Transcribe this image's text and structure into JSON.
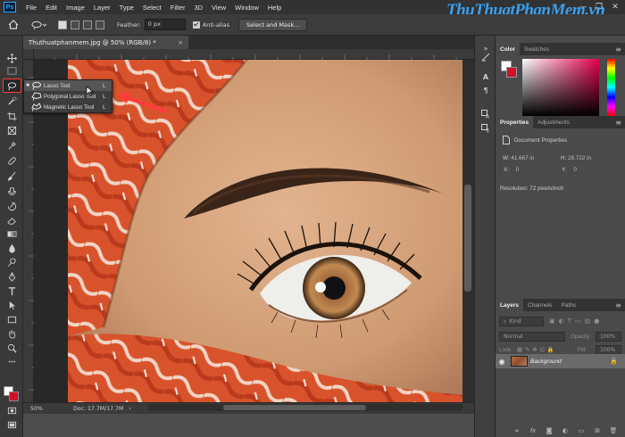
{
  "app": {
    "logo": "Ps"
  },
  "menu": [
    "File",
    "Edit",
    "Image",
    "Layer",
    "Type",
    "Select",
    "Filter",
    "3D",
    "View",
    "Window",
    "Help"
  ],
  "window_controls": {
    "minimize": "—",
    "maximize": "❐",
    "close": "✕"
  },
  "watermark": "ThuThuatPhanMem.vn",
  "options": {
    "feather_label": "Feather:",
    "feather_value": "0 px",
    "antialias_label": "Anti-alias",
    "select_mask_label": "Select and Mask..."
  },
  "document": {
    "tab_title": "Thuthuatphanmem.jpg @ 50% (RGB/8) *",
    "tab_close": "×",
    "zoom": "50%",
    "doc_size": "Doc: 17.7M/17.7M"
  },
  "flyout": {
    "items": [
      {
        "marker": "■",
        "label": "Lasso Tool",
        "key": "L"
      },
      {
        "marker": "",
        "label": "Polygonal Lasso Tool",
        "key": "L"
      },
      {
        "marker": "",
        "label": "Magnetic Lasso Tool",
        "key": "L"
      }
    ]
  },
  "color_panel": {
    "tabs": [
      "Color",
      "Swatches"
    ]
  },
  "properties_panel": {
    "tabs": [
      "Properties",
      "Adjustments"
    ],
    "doc_props": "Document Properties",
    "w_label": "W:",
    "w_value": "41.667 in",
    "h_label": "H:",
    "h_value": "28.722 in",
    "x_label": "X:",
    "x_value": "0",
    "y_label": "Y:",
    "y_value": "0",
    "resolution": "Resolution: 72 pixels/inch"
  },
  "layers_panel": {
    "tabs": [
      "Layers",
      "Channels",
      "Paths"
    ],
    "filter_placeholder": "Kind",
    "blend_mode": "Normal",
    "opacity_label": "Opacity:",
    "opacity_value": "100%",
    "lock_label": "Lock:",
    "fill_label": "Fill:",
    "fill_value": "100%",
    "layer_name": "Background"
  },
  "colors": {
    "foreground": "#ffffff",
    "background": "#d0102a",
    "annotation": "#ff3b3b",
    "accent": "#31a8ff"
  }
}
